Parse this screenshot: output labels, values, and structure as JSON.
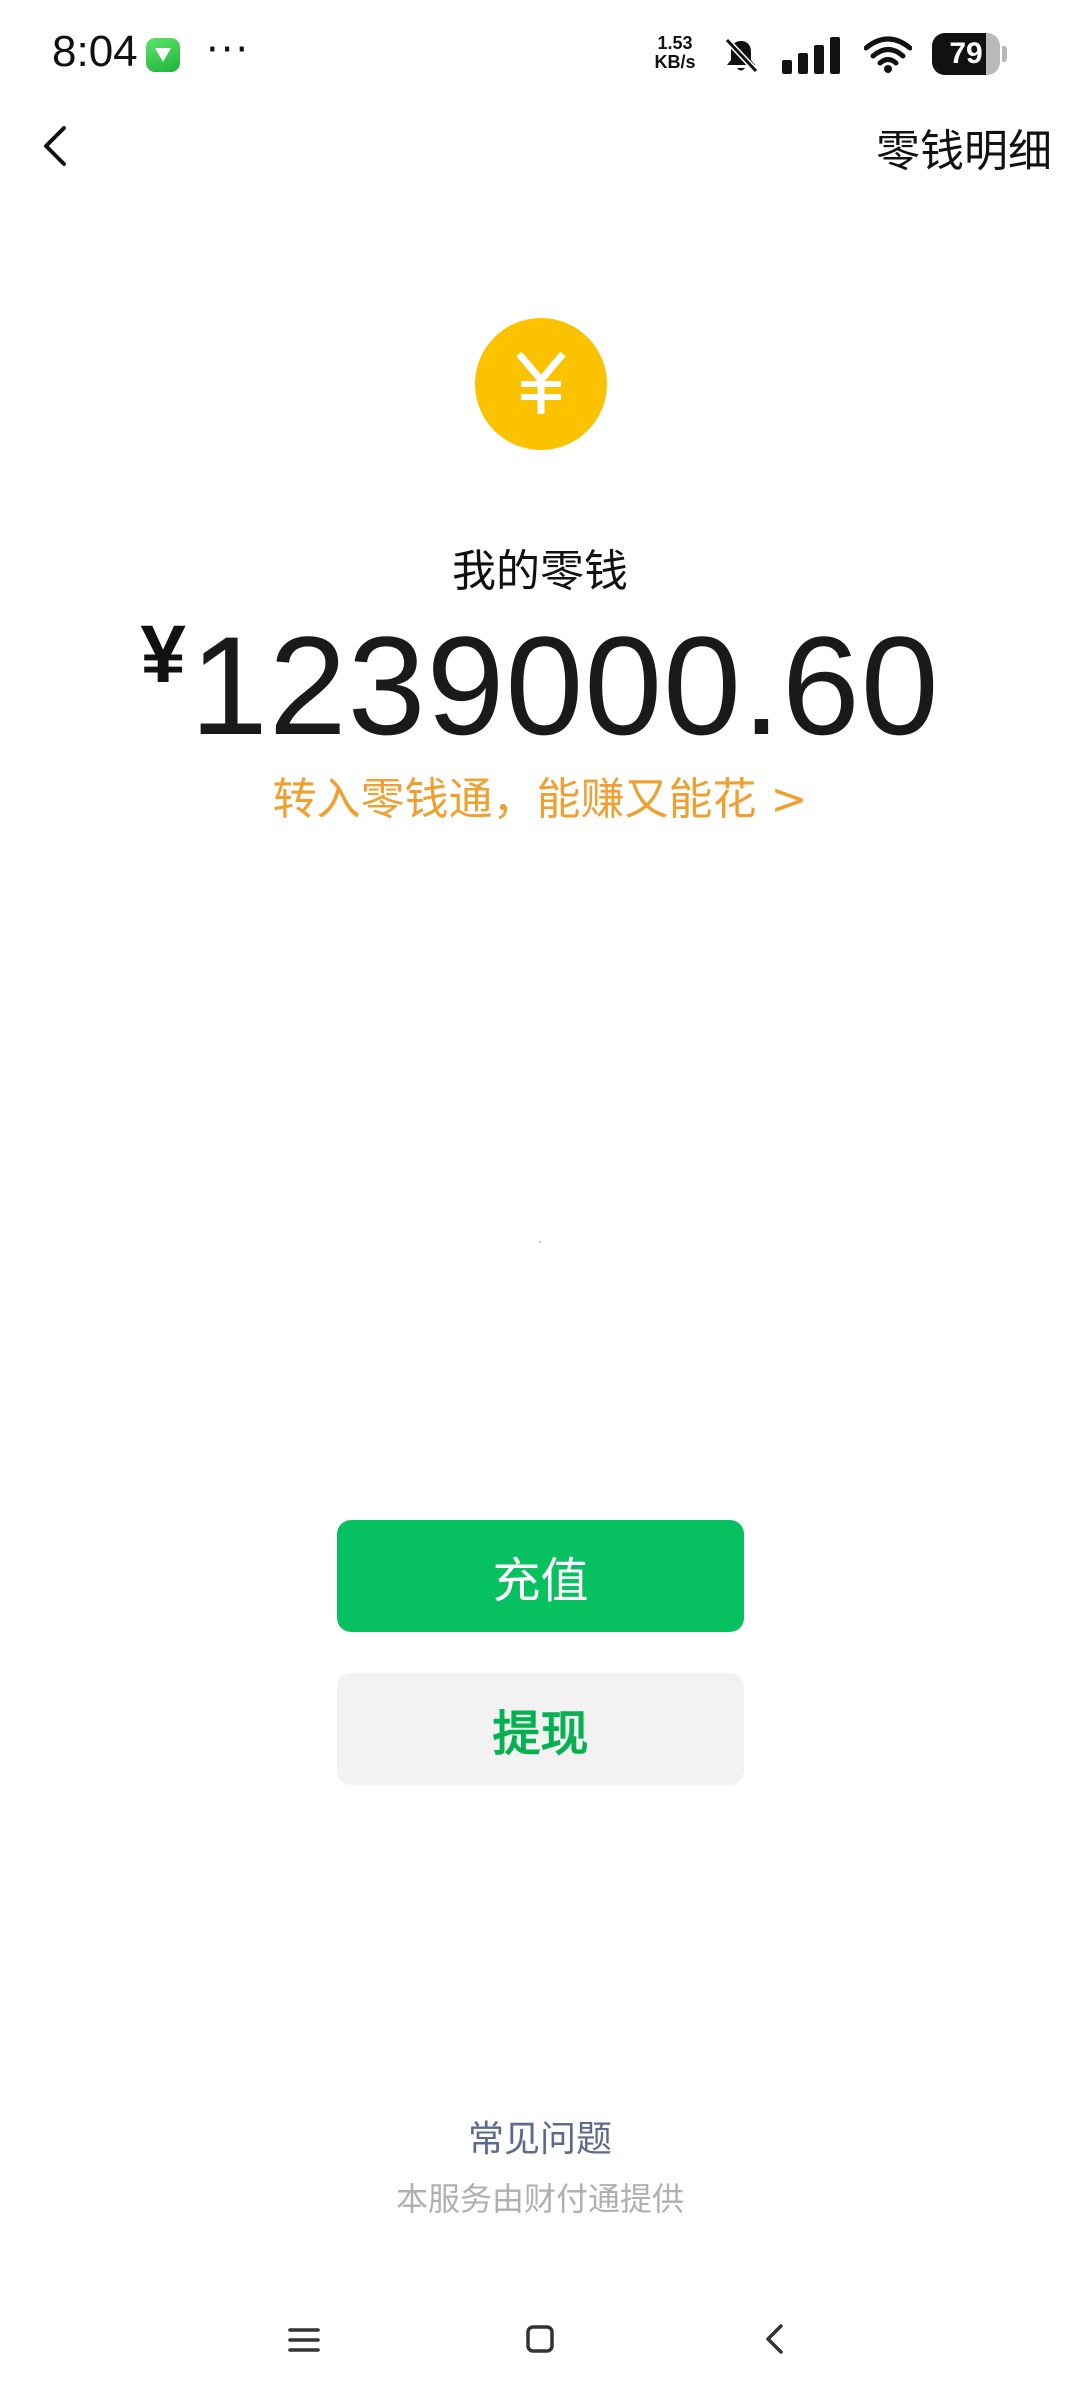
{
  "status_bar": {
    "time": "8:04",
    "more": "···",
    "net_speed_value": "1.53",
    "net_speed_unit": "KB/s",
    "battery_level": "79",
    "battery_fraction": 0.79
  },
  "nav": {
    "detail_link": "零钱明细"
  },
  "wallet": {
    "label": "我的零钱",
    "currency": "¥",
    "balance": "1239000.60",
    "promo": "转入零钱通，能赚又能花 >"
  },
  "actions": {
    "recharge": "充值",
    "withdraw": "提现"
  },
  "footer": {
    "faq": "常见问题",
    "provider": "本服务由财付通提供"
  },
  "colors": {
    "primary_green": "#07c160",
    "coin_yellow": "#fbc200",
    "promo_orange": "#f0a030"
  },
  "icons": {
    "coin": "yuan-coin-icon",
    "back": "chevron-left-icon",
    "bell": "bell-muted-icon",
    "signal": "signal-icon",
    "wifi": "wifi-icon",
    "battery": "battery-icon"
  }
}
